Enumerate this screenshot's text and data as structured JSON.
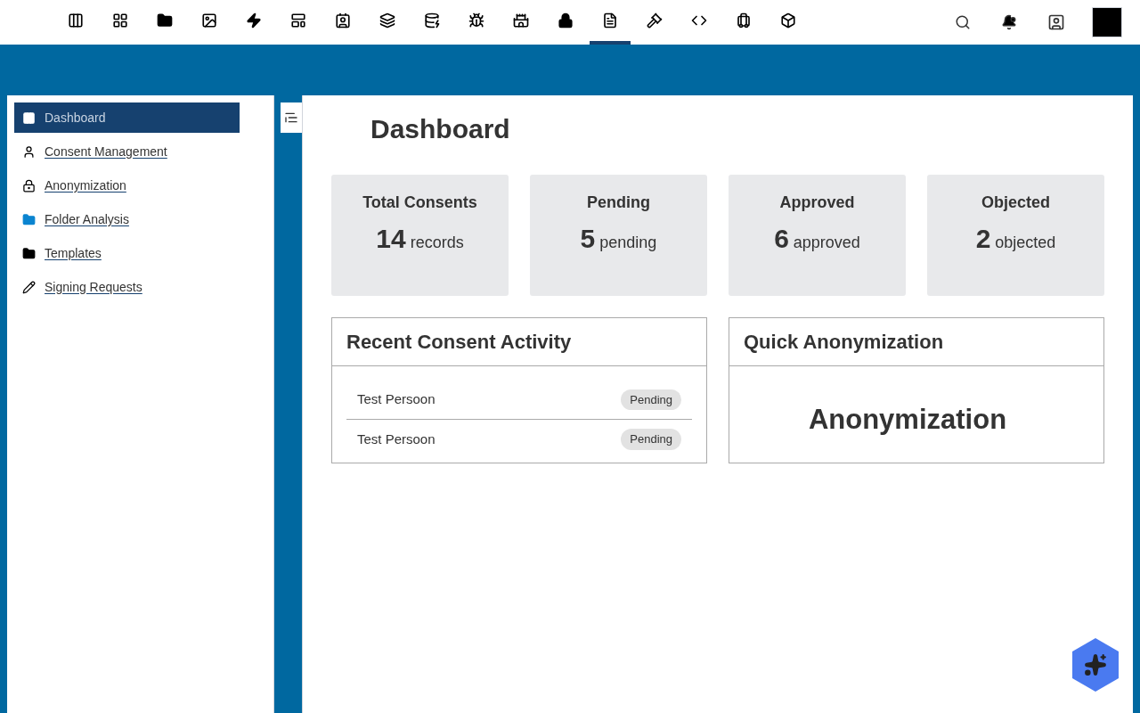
{
  "top_nav": [
    {
      "selected": false
    },
    {
      "selected": false
    },
    {
      "selected": false
    },
    {
      "selected": false
    },
    {
      "selected": false
    },
    {
      "selected": false
    },
    {
      "selected": false
    },
    {
      "selected": false
    },
    {
      "selected": false
    },
    {
      "selected": false
    },
    {
      "selected": false
    },
    {
      "selected": false
    },
    {
      "selected": true
    },
    {
      "selected": false
    },
    {
      "selected": false
    },
    {
      "selected": false
    },
    {
      "selected": false
    }
  ],
  "sidebar": {
    "items": [
      {
        "label": "Dashboard",
        "selected": true
      },
      {
        "label": "Consent Management",
        "selected": false
      },
      {
        "label": "Anonymization",
        "selected": false
      },
      {
        "label": "Folder Analysis",
        "selected": false
      },
      {
        "label": "Templates",
        "selected": false
      },
      {
        "label": "Signing Requests",
        "selected": false
      }
    ]
  },
  "page_title": "Dashboard",
  "stats": [
    {
      "title": "Total Consents",
      "value": "14",
      "unit": "records"
    },
    {
      "title": "Pending",
      "value": "5",
      "unit": "pending"
    },
    {
      "title": "Approved",
      "value": "6",
      "unit": "approved"
    },
    {
      "title": "Objected",
      "value": "2",
      "unit": "objected"
    }
  ],
  "recent_activity": {
    "title": "Recent Consent Activity",
    "rows": [
      {
        "name": "Test Persoon",
        "status": "Pending"
      },
      {
        "name": "Test Persoon",
        "status": "Pending"
      }
    ]
  },
  "quick_anonymization": {
    "title": "Quick Anonymization",
    "heading": "Anonymization"
  }
}
